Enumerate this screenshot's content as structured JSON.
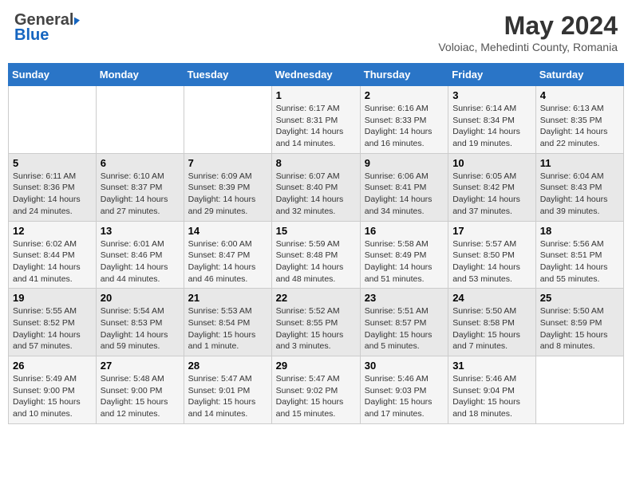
{
  "header": {
    "logo_general": "General",
    "logo_blue": "Blue",
    "main_title": "May 2024",
    "subtitle": "Voloiac, Mehedinti County, Romania"
  },
  "days_of_week": [
    "Sunday",
    "Monday",
    "Tuesday",
    "Wednesday",
    "Thursday",
    "Friday",
    "Saturday"
  ],
  "weeks": [
    [
      {
        "day": "",
        "info": ""
      },
      {
        "day": "",
        "info": ""
      },
      {
        "day": "",
        "info": ""
      },
      {
        "day": "1",
        "info": "Sunrise: 6:17 AM\nSunset: 8:31 PM\nDaylight: 14 hours\nand 14 minutes."
      },
      {
        "day": "2",
        "info": "Sunrise: 6:16 AM\nSunset: 8:33 PM\nDaylight: 14 hours\nand 16 minutes."
      },
      {
        "day": "3",
        "info": "Sunrise: 6:14 AM\nSunset: 8:34 PM\nDaylight: 14 hours\nand 19 minutes."
      },
      {
        "day": "4",
        "info": "Sunrise: 6:13 AM\nSunset: 8:35 PM\nDaylight: 14 hours\nand 22 minutes."
      }
    ],
    [
      {
        "day": "5",
        "info": "Sunrise: 6:11 AM\nSunset: 8:36 PM\nDaylight: 14 hours\nand 24 minutes."
      },
      {
        "day": "6",
        "info": "Sunrise: 6:10 AM\nSunset: 8:37 PM\nDaylight: 14 hours\nand 27 minutes."
      },
      {
        "day": "7",
        "info": "Sunrise: 6:09 AM\nSunset: 8:39 PM\nDaylight: 14 hours\nand 29 minutes."
      },
      {
        "day": "8",
        "info": "Sunrise: 6:07 AM\nSunset: 8:40 PM\nDaylight: 14 hours\nand 32 minutes."
      },
      {
        "day": "9",
        "info": "Sunrise: 6:06 AM\nSunset: 8:41 PM\nDaylight: 14 hours\nand 34 minutes."
      },
      {
        "day": "10",
        "info": "Sunrise: 6:05 AM\nSunset: 8:42 PM\nDaylight: 14 hours\nand 37 minutes."
      },
      {
        "day": "11",
        "info": "Sunrise: 6:04 AM\nSunset: 8:43 PM\nDaylight: 14 hours\nand 39 minutes."
      }
    ],
    [
      {
        "day": "12",
        "info": "Sunrise: 6:02 AM\nSunset: 8:44 PM\nDaylight: 14 hours\nand 41 minutes."
      },
      {
        "day": "13",
        "info": "Sunrise: 6:01 AM\nSunset: 8:46 PM\nDaylight: 14 hours\nand 44 minutes."
      },
      {
        "day": "14",
        "info": "Sunrise: 6:00 AM\nSunset: 8:47 PM\nDaylight: 14 hours\nand 46 minutes."
      },
      {
        "day": "15",
        "info": "Sunrise: 5:59 AM\nSunset: 8:48 PM\nDaylight: 14 hours\nand 48 minutes."
      },
      {
        "day": "16",
        "info": "Sunrise: 5:58 AM\nSunset: 8:49 PM\nDaylight: 14 hours\nand 51 minutes."
      },
      {
        "day": "17",
        "info": "Sunrise: 5:57 AM\nSunset: 8:50 PM\nDaylight: 14 hours\nand 53 minutes."
      },
      {
        "day": "18",
        "info": "Sunrise: 5:56 AM\nSunset: 8:51 PM\nDaylight: 14 hours\nand 55 minutes."
      }
    ],
    [
      {
        "day": "19",
        "info": "Sunrise: 5:55 AM\nSunset: 8:52 PM\nDaylight: 14 hours\nand 57 minutes."
      },
      {
        "day": "20",
        "info": "Sunrise: 5:54 AM\nSunset: 8:53 PM\nDaylight: 14 hours\nand 59 minutes."
      },
      {
        "day": "21",
        "info": "Sunrise: 5:53 AM\nSunset: 8:54 PM\nDaylight: 15 hours\nand 1 minute."
      },
      {
        "day": "22",
        "info": "Sunrise: 5:52 AM\nSunset: 8:55 PM\nDaylight: 15 hours\nand 3 minutes."
      },
      {
        "day": "23",
        "info": "Sunrise: 5:51 AM\nSunset: 8:57 PM\nDaylight: 15 hours\nand 5 minutes."
      },
      {
        "day": "24",
        "info": "Sunrise: 5:50 AM\nSunset: 8:58 PM\nDaylight: 15 hours\nand 7 minutes."
      },
      {
        "day": "25",
        "info": "Sunrise: 5:50 AM\nSunset: 8:59 PM\nDaylight: 15 hours\nand 8 minutes."
      }
    ],
    [
      {
        "day": "26",
        "info": "Sunrise: 5:49 AM\nSunset: 9:00 PM\nDaylight: 15 hours\nand 10 minutes."
      },
      {
        "day": "27",
        "info": "Sunrise: 5:48 AM\nSunset: 9:00 PM\nDaylight: 15 hours\nand 12 minutes."
      },
      {
        "day": "28",
        "info": "Sunrise: 5:47 AM\nSunset: 9:01 PM\nDaylight: 15 hours\nand 14 minutes."
      },
      {
        "day": "29",
        "info": "Sunrise: 5:47 AM\nSunset: 9:02 PM\nDaylight: 15 hours\nand 15 minutes."
      },
      {
        "day": "30",
        "info": "Sunrise: 5:46 AM\nSunset: 9:03 PM\nDaylight: 15 hours\nand 17 minutes."
      },
      {
        "day": "31",
        "info": "Sunrise: 5:46 AM\nSunset: 9:04 PM\nDaylight: 15 hours\nand 18 minutes."
      },
      {
        "day": "",
        "info": ""
      }
    ]
  ]
}
